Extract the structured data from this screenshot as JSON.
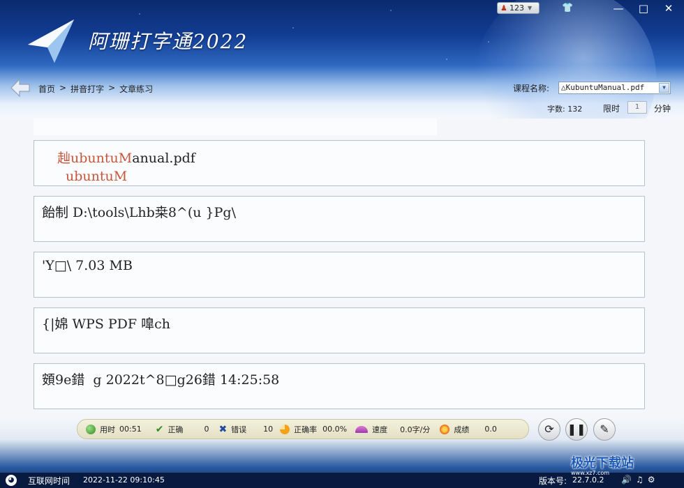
{
  "app": {
    "title": "阿珊打字通2022"
  },
  "window": {
    "user_name": "123"
  },
  "nav": {
    "breadcrumb": [
      "首页",
      ">",
      "拼音打字",
      ">",
      "文章练习"
    ]
  },
  "course": {
    "label": "课程名称:",
    "selected": "△KubuntuManual.pdf"
  },
  "info": {
    "words_label": "字数: 132",
    "limit_label": "限时",
    "limit_value": "1",
    "limit_unit": "分钟"
  },
  "panels": [
    {
      "source": "赸ubuntuManual.pdf",
      "typed_part": "赸ubuntuM",
      "rest_part": "anual.pdf",
      "input": "ubuntuM"
    },
    {
      "source": "飴制 D:\\tools\\Lhb桒8^(u }Pg\\"
    },
    {
      "source": "'Y□\\ 7.03 MB"
    },
    {
      "source": "{|婂 WPS PDF 嘷ch"
    },
    {
      "source": "頞9e錯  g 2022t^8□g26錯 14:25:58"
    }
  ],
  "stats": {
    "time_label": "用时",
    "time_value": "00:51",
    "correct_label": "正确",
    "correct_value": "0",
    "error_label": "错误",
    "error_value": "10",
    "accuracy_label": "正确率",
    "accuracy_value": "00.0%",
    "speed_label": "速度",
    "speed_value": "0.0字/分",
    "score_label": "成绩",
    "score_value": "0.0"
  },
  "footer": {
    "net_time_label": "互联网时间",
    "net_time_value": "2022-11-22 09:10:45",
    "version_label": "版本号:",
    "version_value": "22.7.0.2",
    "watermark": "极光下载站",
    "watermark_sub": "www.xz7.com"
  },
  "colors": {
    "typed": "#c8553a",
    "header_blue": "#123d93"
  }
}
